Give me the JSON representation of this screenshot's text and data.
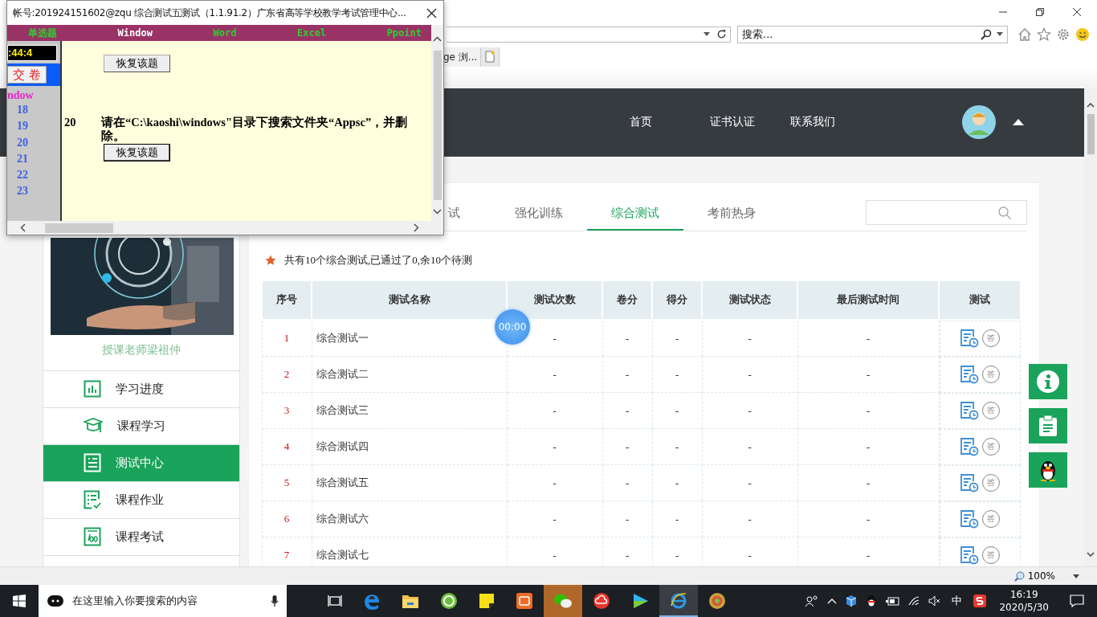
{
  "popup": {
    "title": "帐号:201924151602@zqu  综合测试五测试（1.1.91.2）广东省高等学校教学考试管理中心...",
    "categories": [
      {
        "label": "单选题",
        "selected": false
      },
      {
        "label": "Window",
        "selected": true
      },
      {
        "label": "Word",
        "selected": false
      },
      {
        "label": "Excel",
        "selected": false
      },
      {
        "label": "Ppoint",
        "selected": false
      }
    ],
    "timer": ":44:4",
    "submit_button": "交 卷",
    "section_label": "ndow",
    "question_numbers": [
      "18",
      "19",
      "20",
      "21",
      "22",
      "23"
    ],
    "questions": [
      {
        "button": "恢复该题",
        "focused": false
      },
      {
        "number": "20",
        "text": "请在“C:\\kaoshi\\windows\"目录下搜索文件夹“Appsc”，并删除。",
        "button": "恢复该题",
        "focused": true
      }
    ]
  },
  "browser": {
    "search_placeholder": "搜索...",
    "tab": "ge 浏...",
    "zoom": "100%"
  },
  "site": {
    "nav": [
      "首页",
      "证书认证",
      "联系我们"
    ],
    "teacher": "授课老师梁祖仲",
    "menu": [
      {
        "label": "学习进度",
        "kind": "chart",
        "selected": false
      },
      {
        "label": "课程学习",
        "kind": "cap",
        "selected": false
      },
      {
        "label": "测试中心",
        "kind": "list",
        "selected": true
      },
      {
        "label": "课程作业",
        "kind": "checklist",
        "selected": false
      },
      {
        "label": "课程考试",
        "kind": "score",
        "selected": false
      }
    ],
    "tabs": [
      {
        "label": "试",
        "selected": false
      },
      {
        "label": "强化训练",
        "selected": false
      },
      {
        "label": "综合测试",
        "selected": true
      },
      {
        "label": "考前热身",
        "selected": false
      }
    ],
    "summary": "共有10个综合测试,已通过了0,余10个待测",
    "table": {
      "columns": [
        "序号",
        "测试名称",
        "测试次数",
        "卷分",
        "得分",
        "测试状态",
        "最后测试时间",
        "测试"
      ],
      "rows": [
        {
          "cells": [
            "1",
            "综合测试一",
            "-",
            "-",
            "-",
            "-",
            "-"
          ],
          "answer": "答"
        },
        {
          "cells": [
            "2",
            "综合测试二",
            "-",
            "-",
            "-",
            "-",
            "-"
          ],
          "answer": "答"
        },
        {
          "cells": [
            "3",
            "综合测试三",
            "-",
            "-",
            "-",
            "-",
            "-"
          ],
          "answer": "答"
        },
        {
          "cells": [
            "4",
            "综合测试四",
            "-",
            "-",
            "-",
            "-",
            "-"
          ],
          "answer": "答"
        },
        {
          "cells": [
            "5",
            "综合测试五",
            "-",
            "-",
            "-",
            "-",
            "-"
          ],
          "answer": "答"
        },
        {
          "cells": [
            "6",
            "综合测试六",
            "-",
            "-",
            "-",
            "-",
            "-"
          ],
          "answer": "答"
        },
        {
          "cells": [
            "7",
            "综合测试七",
            "-",
            "-",
            "-",
            "-",
            "-"
          ],
          "answer": "答"
        }
      ]
    },
    "timer_badge": "00:00"
  },
  "taskbar": {
    "search_placeholder": "在这里输入你要搜索的内容",
    "ime": "中",
    "time": "16:19",
    "date": "2020/5/30"
  }
}
